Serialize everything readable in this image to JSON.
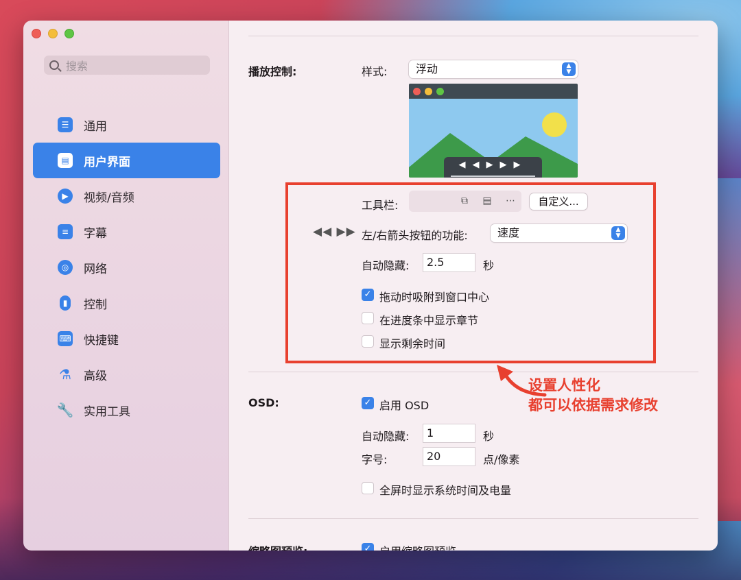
{
  "window": {
    "traffic_lights": [
      "close",
      "minimize",
      "zoom"
    ]
  },
  "search": {
    "placeholder": "搜索"
  },
  "sidebar": {
    "items": [
      {
        "label": "通用",
        "icon": "toggles-icon",
        "active": false
      },
      {
        "label": "用户界面",
        "icon": "window-icon",
        "active": true
      },
      {
        "label": "视频/音频",
        "icon": "play-circle-icon",
        "active": false
      },
      {
        "label": "字幕",
        "icon": "subtitle-bubble-icon",
        "active": false
      },
      {
        "label": "网络",
        "icon": "globe-icon",
        "active": false
      },
      {
        "label": "控制",
        "icon": "mouse-icon",
        "active": false
      },
      {
        "label": "快捷键",
        "icon": "keyboard-icon",
        "active": false
      },
      {
        "label": "高级",
        "icon": "flask-icon",
        "active": false
      },
      {
        "label": "实用工具",
        "icon": "wrench-icon",
        "active": false
      }
    ]
  },
  "playback": {
    "section_label": "播放控制:",
    "style_label": "样式:",
    "style_value": "浮动",
    "toolbar_label": "工具栏:",
    "customize_button": "自定义...",
    "arrow_label": "左/右箭头按钮的功能:",
    "arrow_value": "速度",
    "autohide_label": "自动隐藏:",
    "autohide_value": "2.5",
    "autohide_unit": "秒",
    "checkboxes": [
      {
        "label": "拖动时吸附到窗口中心",
        "checked": true
      },
      {
        "label": "在进度条中显示章节",
        "checked": false
      },
      {
        "label": "显示剩余时间",
        "checked": false
      }
    ]
  },
  "osd": {
    "section_label": "OSD:",
    "enable_label": "启用 OSD",
    "enable_checked": true,
    "autohide_label": "自动隐藏:",
    "autohide_value": "1",
    "autohide_unit": "秒",
    "fontsize_label": "字号:",
    "fontsize_value": "20",
    "fontsize_unit": "点/像素",
    "fullscreen_label": "全屏时显示系统时间及电量",
    "fullscreen_checked": false
  },
  "thumbnail": {
    "section_label": "缩略图预览:",
    "enable_label": "启用缩略图预览",
    "enable_checked": true
  },
  "annotation": {
    "line1": "设置人性化",
    "line2": "都可以依据需求修改",
    "color": "#e8402f"
  },
  "colors": {
    "accent": "#3a82e8",
    "highlight_box": "#e8402f"
  }
}
